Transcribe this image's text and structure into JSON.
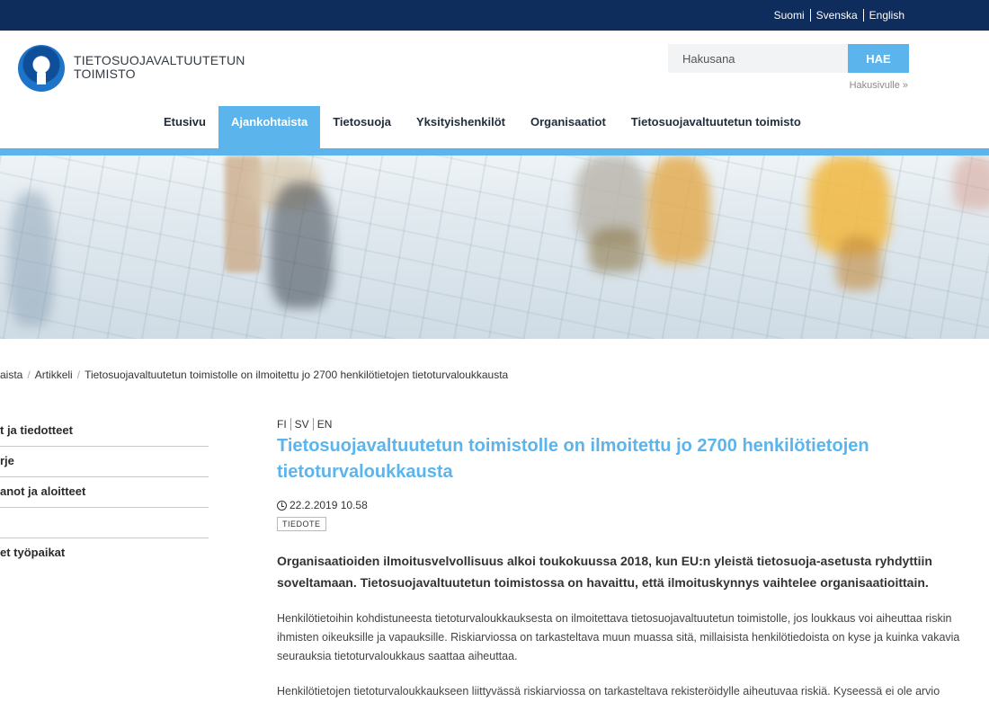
{
  "languages": [
    "Suomi",
    "Svenska",
    "English"
  ],
  "logo": {
    "line1": "TIETOSUOJAVALTUUTETUN",
    "line2": "TOIMISTO"
  },
  "search": {
    "placeholder": "Hakusana",
    "button": "HAE",
    "advanced_link": "Hakusivulle »"
  },
  "nav": {
    "items": [
      {
        "label": "Etusivu",
        "active": false
      },
      {
        "label": "Ajankohtaista",
        "active": true
      },
      {
        "label": "Tietosuoja",
        "active": false
      },
      {
        "label": "Yksityishenkilöt",
        "active": false
      },
      {
        "label": "Organisaatiot",
        "active": false
      },
      {
        "label": "Tietosuojavaltuutetun toimisto",
        "active": false
      }
    ]
  },
  "breadcrumb": [
    "aista",
    "Artikkeli",
    "Tietosuojavaltuutetun toimistolle on ilmoitettu jo 2700 henkilötietojen tietoturvaloukkausta"
  ],
  "sidebar": {
    "items": [
      "t ja tiedotteet",
      "rje",
      "anot ja aloitteet",
      "",
      "et työpaikat"
    ]
  },
  "article": {
    "languages": [
      "FI",
      "SV",
      "EN"
    ],
    "title": "Tietosuojavaltuutetun toimistolle on ilmoitettu jo 2700 henkilötietojen tietoturvaloukkausta",
    "date": "22.2.2019 10.58",
    "tag": "TIEDOTE",
    "lead": "Organisaatioiden ilmoitusvelvollisuus alkoi toukokuussa 2018, kun EU:n yleistä tietosuoja-asetusta ryhdyttiin soveltamaan. Tietosuojavaltuutetun toimistossa on havaittu, että ilmoituskynnys vaihtelee organisaatioittain.",
    "paragraph1": "Henkilötietoihin kohdistuneesta tietoturvaloukkauksesta on ilmoitettava tietosuojavaltuutetun toimistolle, jos loukkaus voi aiheuttaa riskin ihmisten oikeuksille ja vapauksille. Riskiarviossa on tarkasteltava muun muassa sitä, millaisista henkilötiedoista on kyse ja kuinka vakavia seurauksia tietoturvaloukkaus saattaa aiheuttaa.",
    "paragraph2": "Henkilötietojen tietoturvaloukkaukseen liittyvässä riskiarviossa on tarkasteltava rekisteröidylle aiheutuvaa riskiä. Kyseessä ei ole arvio"
  },
  "colors": {
    "topbar": "#0e2d5c",
    "accent": "#5bb5ec"
  }
}
